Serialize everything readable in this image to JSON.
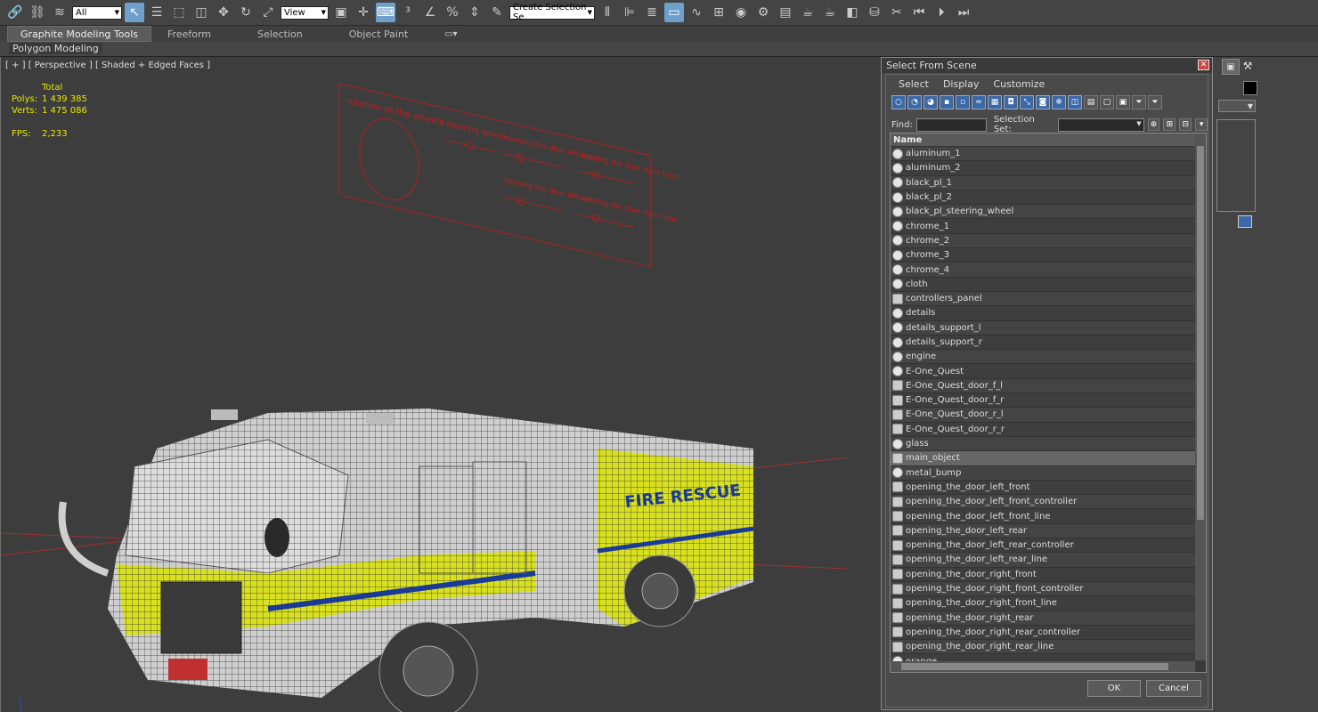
{
  "toolbar": {
    "filter_value": "All",
    "refcoord_value": "View",
    "selection_set_placeholder": "Create Selection Se"
  },
  "ribbon": {
    "tabs": [
      "Graphite Modeling Tools",
      "Freeform",
      "Selection",
      "Object Paint"
    ],
    "subtab": "Polygon Modeling"
  },
  "viewport": {
    "label": "[ + ] [ Perspective ] [ Shaded + Edged Faces ]",
    "stats_total_label": "Total",
    "polys_label": "Polys:",
    "polys_value": "1 439 385",
    "verts_label": "Verts:",
    "verts_value": "1 475 086",
    "fps_label": "FPS:",
    "fps_value": "2,233",
    "truck_lettering": "FIRE RESCUE",
    "panel_labels": [
      "rotation of the wheels",
      "steering wheel",
      "opening the door left front",
      "opening the door right front",
      "opening the door left rear",
      "opening the door right rear"
    ]
  },
  "dialog": {
    "title": "Select From Scene",
    "menu": [
      "Select",
      "Display",
      "Customize"
    ],
    "find_label": "Find:",
    "selection_set_label": "Selection Set:",
    "column_name": "Name",
    "ok_label": "OK",
    "cancel_label": "Cancel",
    "items": [
      {
        "name": "aluminum_1",
        "type": "object",
        "selected": false
      },
      {
        "name": "aluminum_2",
        "type": "object",
        "selected": false
      },
      {
        "name": "black_pl_1",
        "type": "object",
        "selected": false
      },
      {
        "name": "black_pl_2",
        "type": "object",
        "selected": false
      },
      {
        "name": "black_pl_steering_wheel",
        "type": "object",
        "selected": false
      },
      {
        "name": "chrome_1",
        "type": "object",
        "selected": false
      },
      {
        "name": "chrome_2",
        "type": "object",
        "selected": false
      },
      {
        "name": "chrome_3",
        "type": "object",
        "selected": false
      },
      {
        "name": "chrome_4",
        "type": "object",
        "selected": false
      },
      {
        "name": "cloth",
        "type": "object",
        "selected": false
      },
      {
        "name": "controllers_panel",
        "type": "group",
        "selected": false
      },
      {
        "name": "details",
        "type": "object",
        "selected": false
      },
      {
        "name": "details_support_l",
        "type": "object",
        "selected": false
      },
      {
        "name": "details_support_r",
        "type": "object",
        "selected": false
      },
      {
        "name": "engine",
        "type": "object",
        "selected": false
      },
      {
        "name": "E-One_Quest",
        "type": "object",
        "selected": false
      },
      {
        "name": "E-One_Quest_door_f_l",
        "type": "group",
        "selected": false
      },
      {
        "name": "E-One_Quest_door_f_r",
        "type": "group",
        "selected": false
      },
      {
        "name": "E-One_Quest_door_r_l",
        "type": "group",
        "selected": false
      },
      {
        "name": "E-One_Quest_door_r_r",
        "type": "group",
        "selected": false
      },
      {
        "name": "glass",
        "type": "object",
        "selected": false
      },
      {
        "name": "main_object",
        "type": "group",
        "selected": true
      },
      {
        "name": "metal_bump",
        "type": "object",
        "selected": false
      },
      {
        "name": "opening_the_door_left_front",
        "type": "group",
        "selected": false
      },
      {
        "name": "opening_the_door_left_front_controller",
        "type": "group",
        "selected": false
      },
      {
        "name": "opening_the_door_left_front_line",
        "type": "group",
        "selected": false
      },
      {
        "name": "opening_the_door_left_rear",
        "type": "group",
        "selected": false
      },
      {
        "name": "opening_the_door_left_rear_controller",
        "type": "group",
        "selected": false
      },
      {
        "name": "opening_the_door_left_rear_line",
        "type": "group",
        "selected": false
      },
      {
        "name": "opening_the_door_right_front",
        "type": "group",
        "selected": false
      },
      {
        "name": "opening_the_door_right_front_controller",
        "type": "group",
        "selected": false
      },
      {
        "name": "opening_the_door_right_front_line",
        "type": "group",
        "selected": false
      },
      {
        "name": "opening_the_door_right_rear",
        "type": "group",
        "selected": false
      },
      {
        "name": "opening_the_door_right_rear_controller",
        "type": "group",
        "selected": false
      },
      {
        "name": "opening_the_door_right_rear_line",
        "type": "group",
        "selected": false
      },
      {
        "name": "orange",
        "type": "object",
        "selected": false
      }
    ]
  }
}
